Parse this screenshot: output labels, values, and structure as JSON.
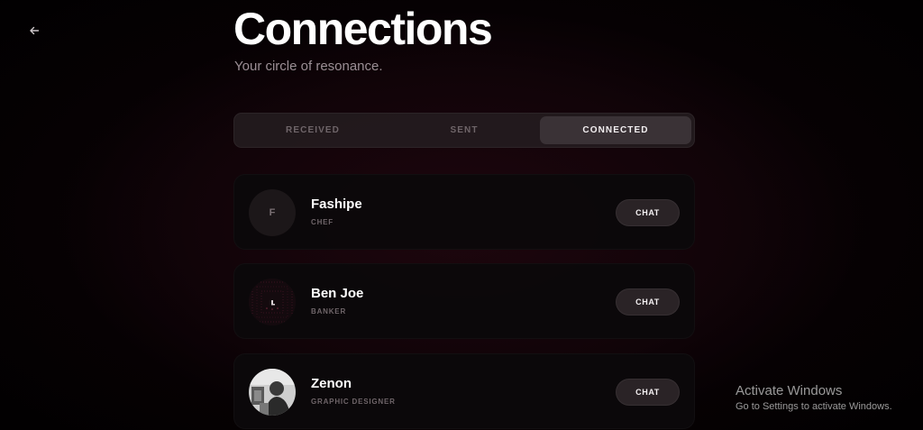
{
  "header": {
    "title": "Connections",
    "subtitle": "Your circle of resonance."
  },
  "tabs": [
    {
      "label": "RECEIVED",
      "active": false
    },
    {
      "label": "SENT",
      "active": false
    },
    {
      "label": "CONNECTED",
      "active": true
    }
  ],
  "connections": [
    {
      "name": "Fashipe",
      "role": "CHEF",
      "avatar_initial": "F",
      "avatar_type": "initial",
      "action_label": "CHAT"
    },
    {
      "name": "Ben Joe",
      "role": "BANKER",
      "avatar_initial": "",
      "avatar_type": "photo-dark",
      "action_label": "CHAT"
    },
    {
      "name": "Zenon",
      "role": "GRAPHIC DESIGNER",
      "avatar_initial": "",
      "avatar_type": "photo-bw",
      "action_label": "CHAT"
    }
  ],
  "os_watermark": {
    "title": "Activate Windows",
    "subtitle": "Go to Settings to activate Windows."
  },
  "icons": {
    "back": "arrow-left-icon"
  },
  "colors": {
    "background": "#000000",
    "card": "#0b080a",
    "tab_active": "#3a3236",
    "muted_text": "#6f6569"
  }
}
